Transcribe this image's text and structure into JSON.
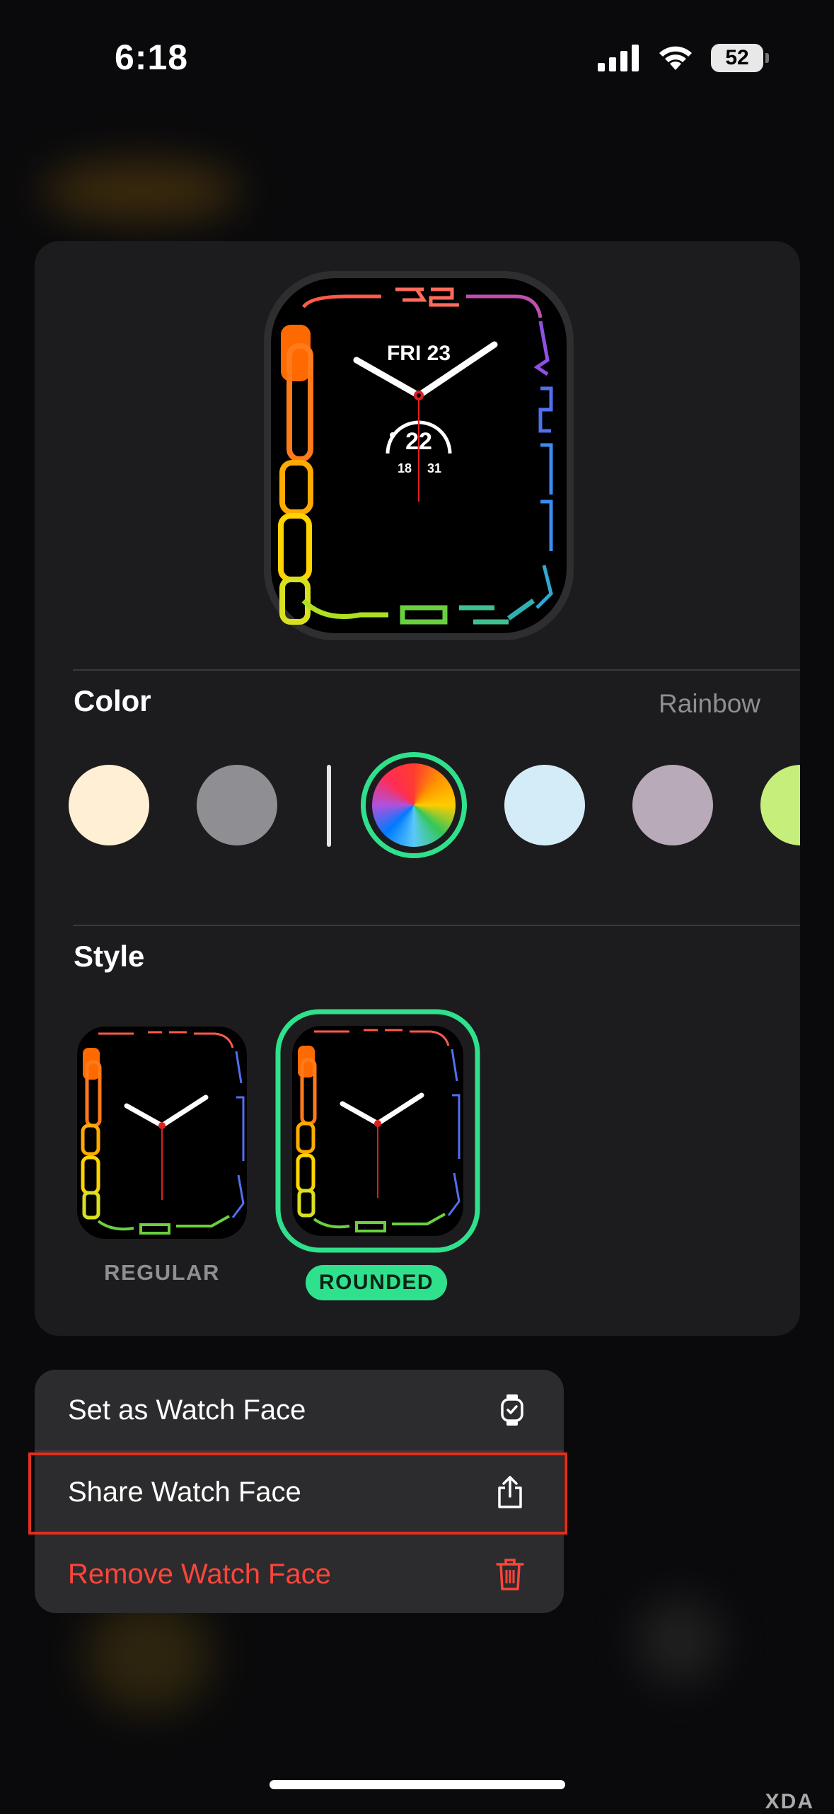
{
  "status_bar": {
    "time": "6:18",
    "battery": "52"
  },
  "watch_preview": {
    "date": "FRI 23",
    "complication": {
      "value": "22",
      "min": "18",
      "max": "31"
    }
  },
  "color_section": {
    "title": "Color",
    "selected_value": "Rainbow",
    "swatches": [
      {
        "name": "cream",
        "color": "#ffefd4"
      },
      {
        "name": "gray",
        "color": "#8e8e93"
      },
      {
        "name": "rainbow",
        "color": "rainbow",
        "selected": true
      },
      {
        "name": "light-blue",
        "color": "#d4ecf7"
      },
      {
        "name": "mauve",
        "color": "#b8aab8"
      },
      {
        "name": "lime",
        "color": "#c5ef7a"
      }
    ]
  },
  "style_section": {
    "title": "Style",
    "options": [
      {
        "label": "REGULAR",
        "selected": false
      },
      {
        "label": "ROUNDED",
        "selected": true
      }
    ]
  },
  "menu": {
    "items": [
      {
        "label": "Set as Watch Face",
        "icon": "watch-icon",
        "color": "#ffffff"
      },
      {
        "label": "Share Watch Face",
        "icon": "share-icon",
        "color": "#ffffff"
      },
      {
        "label": "Remove Watch Face",
        "icon": "trash-icon",
        "color": "#ff453a"
      }
    ]
  },
  "colors": {
    "accent": "#2fe18c",
    "destructive": "#ff453a",
    "highlight": "#e0301e"
  },
  "watermark": "XDA"
}
